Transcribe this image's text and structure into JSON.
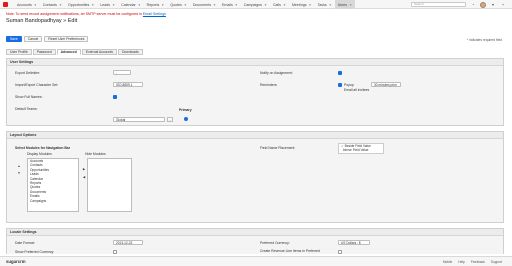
{
  "nav": {
    "items": [
      {
        "label": "Accounts"
      },
      {
        "label": "Contacts"
      },
      {
        "label": "Opportunities"
      },
      {
        "label": "Leads"
      },
      {
        "label": "Calendar"
      },
      {
        "label": "Reports"
      },
      {
        "label": "Quotes"
      },
      {
        "label": "Documents"
      },
      {
        "label": "Emails"
      },
      {
        "label": "Campaigns"
      },
      {
        "label": "Calls"
      },
      {
        "label": "Meetings"
      },
      {
        "label": "Tasks"
      },
      {
        "label": "Users"
      }
    ],
    "search_placeholder": "Search",
    "active_index": 13
  },
  "notice": {
    "text": "Note: To send record assignment notifications, an SMTP server must be configured in ",
    "link": "Email Settings"
  },
  "page": {
    "title": "Suman Bandopadhyay » Edit"
  },
  "buttons": {
    "save": "Save",
    "cancel": "Cancel",
    "reset": "Reset User Preferences"
  },
  "required_note": "* Indicates required field",
  "tabs": [
    "User Profile",
    "Password",
    "Advanced",
    "External Accounts",
    "Downloads"
  ],
  "user_settings": {
    "heading": "User Settings",
    "export_delimiter_label": "Export Delimiter:",
    "export_delimiter_value": ",",
    "charset_label": "Import/Export Character Set:",
    "charset_value": "ISO-8859-1",
    "show_full_names_label": "Show Full Names:",
    "default_teams_label": "Default Teams:",
    "team_value": "Global",
    "primary_label": "Primary",
    "notify_label": "Notify on Assignment:",
    "reminders_label": "Reminders:",
    "popup_label": "Popup",
    "email_invitees_label": "Email all invitees",
    "reminder_time": "30 minutes prior"
  },
  "layout": {
    "heading": "Layout Options",
    "select_modules_label": "Select Modules for Navigation Bar",
    "display_modules_label": "Display Modules",
    "hide_modules_label": "Hide Modules",
    "display_modules": [
      "Accounts",
      "Contacts",
      "Opportunities",
      "Leads",
      "Calendar",
      "Reports",
      "Quotes",
      "Documents",
      "Emails",
      "Campaigns"
    ],
    "field_name_placement_label": "Field Name Placement:",
    "placement_options": [
      "Beside Field Value",
      "Above Field Value"
    ],
    "placement_selected": "Beside Field Value"
  },
  "locale": {
    "heading": "Locale Settings",
    "date_format_label": "Date Format:",
    "date_format_value": "2013-12-23",
    "currency_label": "Preferred Currency:",
    "currency_value": "US Dollars : $",
    "show_pref_currency_label": "Show Preferred Currency:",
    "revenue_label": "Create Revenue Line Items in Preferred"
  },
  "footer": {
    "logo": "sugarcrm",
    "links": [
      "Mobile",
      "Help",
      "Feedback",
      "Support"
    ]
  }
}
